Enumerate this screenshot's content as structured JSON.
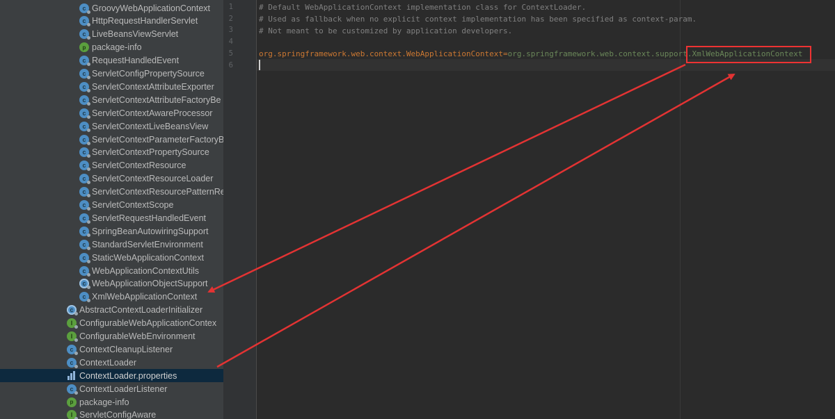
{
  "project_tree": {
    "items": [
      {
        "label": "GroovyWebApplicationContext",
        "icon": "class-icon",
        "indent": 2
      },
      {
        "label": "HttpRequestHandlerServlet",
        "icon": "class-icon",
        "indent": 2
      },
      {
        "label": "LiveBeansViewServlet",
        "icon": "class-icon",
        "indent": 2
      },
      {
        "label": "package-info",
        "icon": "package-info-icon",
        "indent": 2
      },
      {
        "label": "RequestHandledEvent",
        "icon": "class-icon",
        "indent": 2
      },
      {
        "label": "ServletConfigPropertySource",
        "icon": "class-icon",
        "indent": 2
      },
      {
        "label": "ServletContextAttributeExporter",
        "icon": "class-icon",
        "indent": 2
      },
      {
        "label": "ServletContextAttributeFactoryBe",
        "icon": "class-icon",
        "indent": 2
      },
      {
        "label": "ServletContextAwareProcessor",
        "icon": "class-icon",
        "indent": 2
      },
      {
        "label": "ServletContextLiveBeansView",
        "icon": "class-icon",
        "indent": 2
      },
      {
        "label": "ServletContextParameterFactoryB",
        "icon": "class-icon",
        "indent": 2
      },
      {
        "label": "ServletContextPropertySource",
        "icon": "class-icon",
        "indent": 2
      },
      {
        "label": "ServletContextResource",
        "icon": "class-icon",
        "indent": 2
      },
      {
        "label": "ServletContextResourceLoader",
        "icon": "class-icon",
        "indent": 2
      },
      {
        "label": "ServletContextResourcePatternRe",
        "icon": "class-icon",
        "indent": 2
      },
      {
        "label": "ServletContextScope",
        "icon": "class-icon",
        "indent": 2
      },
      {
        "label": "ServletRequestHandledEvent",
        "icon": "class-icon",
        "indent": 2
      },
      {
        "label": "SpringBeanAutowiringSupport",
        "icon": "class-icon",
        "indent": 2
      },
      {
        "label": "StandardServletEnvironment",
        "icon": "class-icon",
        "indent": 2
      },
      {
        "label": "StaticWebApplicationContext",
        "icon": "class-icon",
        "indent": 2
      },
      {
        "label": "WebApplicationContextUtils",
        "icon": "class-icon",
        "indent": 2
      },
      {
        "label": "WebApplicationObjectSupport",
        "icon": "abstract-class-icon",
        "indent": 2
      },
      {
        "label": "XmlWebApplicationContext",
        "icon": "class-icon",
        "indent": 2
      },
      {
        "label": "AbstractContextLoaderInitializer",
        "icon": "abstract-class-icon",
        "indent": 1
      },
      {
        "label": "ConfigurableWebApplicationContex",
        "icon": "interface-icon",
        "indent": 1
      },
      {
        "label": "ConfigurableWebEnvironment",
        "icon": "interface-icon",
        "indent": 1
      },
      {
        "label": "ContextCleanupListener",
        "icon": "class-icon",
        "indent": 1
      },
      {
        "label": "ContextLoader",
        "icon": "class-icon",
        "indent": 1
      },
      {
        "label": "ContextLoader.properties",
        "icon": "properties-file-icon",
        "indent": 1,
        "selected": true
      },
      {
        "label": "ContextLoaderListener",
        "icon": "class-icon",
        "indent": 1
      },
      {
        "label": "package-info",
        "icon": "package-info-icon",
        "indent": 1
      },
      {
        "label": "ServletConfigAware",
        "icon": "interface-icon",
        "indent": 1
      }
    ]
  },
  "editor": {
    "line_numbers": [
      "1",
      "2",
      "3",
      "4",
      "5",
      "6"
    ],
    "lines": {
      "l1": "# Default WebApplicationContext implementation class for ContextLoader.",
      "l2": "# Used as fallback when no explicit context implementation has been specified as context-param.",
      "l3": "# Not meant to be customized by application developers.",
      "l5_key": "org.springframework.web.context.WebApplicationContext",
      "l5_eq": "=",
      "l5_value": "org.springframework.web.context.support.XmlWebApplicationContext"
    }
  },
  "colors": {
    "annotation": "#e33333",
    "selection": "#0d293e",
    "key": "#cc7832",
    "value": "#6a8759",
    "comment": "#808080"
  }
}
